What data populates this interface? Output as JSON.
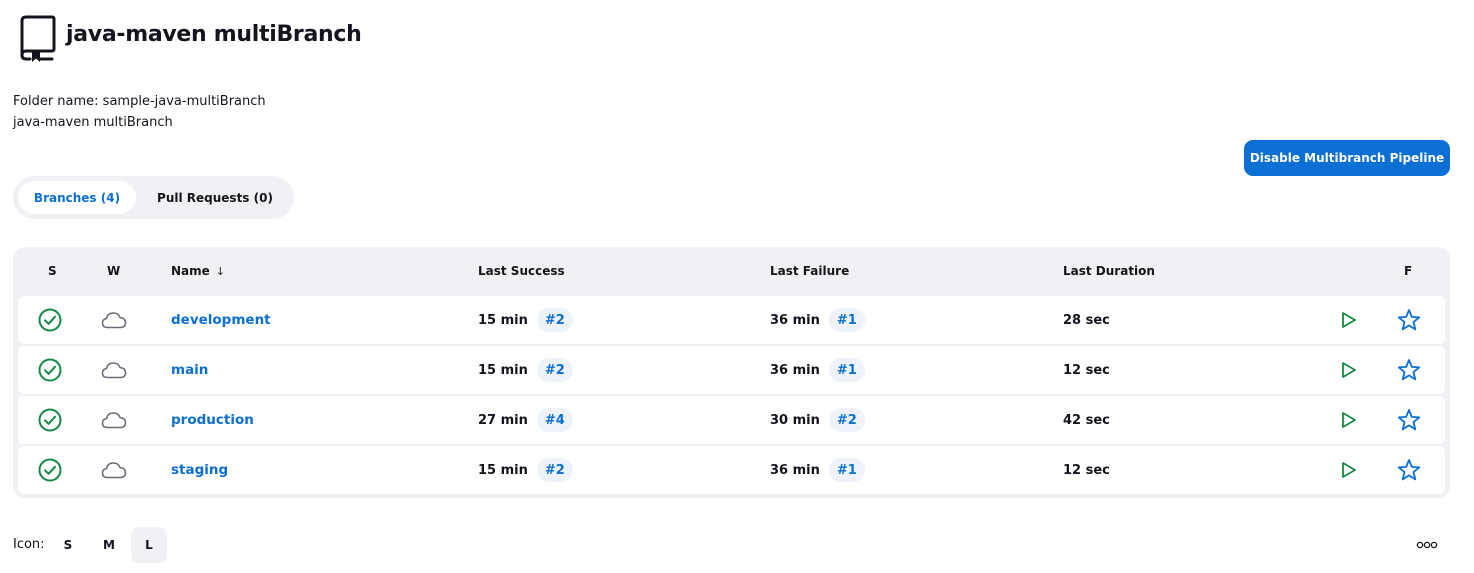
{
  "header": {
    "icon": "multibranch-folder-icon",
    "title": "java-maven multiBranch"
  },
  "description": {
    "folder_name_line": "Folder name: sample-java-multiBranch",
    "description_line": "java-maven multiBranch"
  },
  "actions": {
    "disable_label": "Disable Multibranch Pipeline"
  },
  "tabs": [
    {
      "label": "Branches (4)",
      "active": true
    },
    {
      "label": "Pull Requests (0)",
      "active": false
    }
  ],
  "table": {
    "columns": {
      "status": "S",
      "weather": "W",
      "name": "Name",
      "name_sort": "↓",
      "last_success": "Last Success",
      "last_failure": "Last Failure",
      "last_duration": "Last Duration",
      "favorite": "F"
    },
    "rows": [
      {
        "status": "success-icon",
        "weather": "cloud-icon",
        "name": "development",
        "last_success": "15 min",
        "last_success_build": "#2",
        "last_failure": "36 min",
        "last_failure_build": "#1",
        "last_duration": "28 sec"
      },
      {
        "status": "success-icon",
        "weather": "cloud-icon",
        "name": "main",
        "last_success": "15 min",
        "last_success_build": "#2",
        "last_failure": "36 min",
        "last_failure_build": "#1",
        "last_duration": "12 sec"
      },
      {
        "status": "success-icon",
        "weather": "cloud-icon",
        "name": "production",
        "last_success": "27 min",
        "last_success_build": "#4",
        "last_failure": "30 min",
        "last_failure_build": "#2",
        "last_duration": "42 sec"
      },
      {
        "status": "success-icon",
        "weather": "cloud-icon",
        "name": "staging",
        "last_success": "15 min",
        "last_success_build": "#2",
        "last_failure": "36 min",
        "last_failure_build": "#1",
        "last_duration": "12 sec"
      }
    ]
  },
  "icon_size": {
    "label": "Icon:",
    "options": [
      "S",
      "M",
      "L"
    ],
    "selected": "L"
  },
  "colors": {
    "accent": "#0b6fd3",
    "success": "#138a43",
    "panel": "#f1f1f5"
  }
}
